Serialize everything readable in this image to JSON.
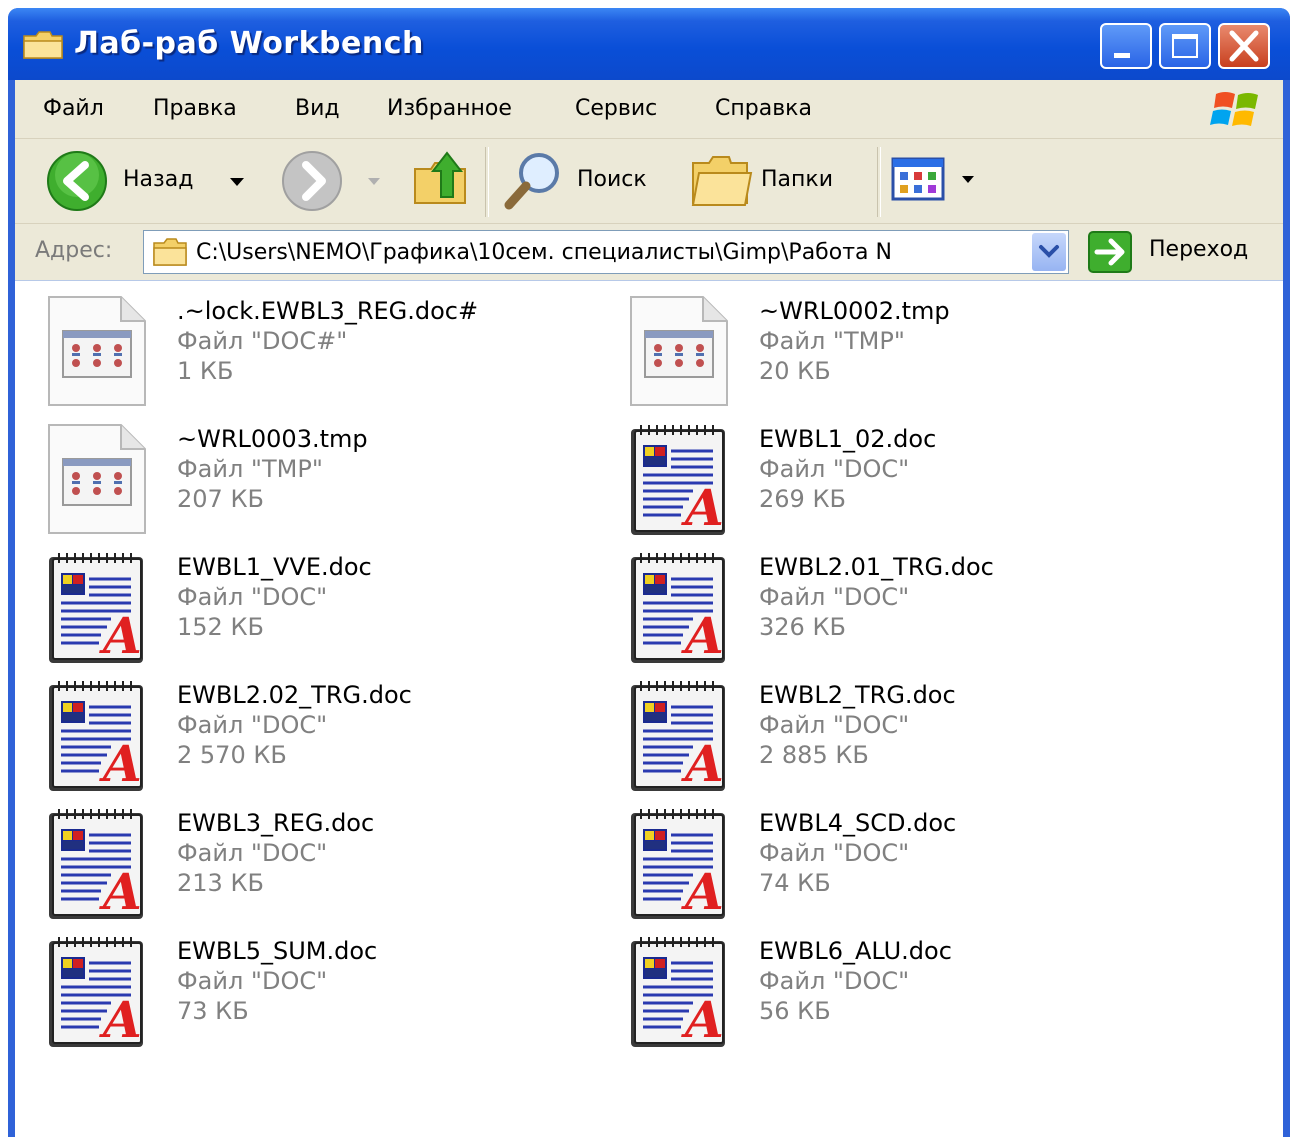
{
  "window": {
    "title": "Лаб-раб Workbench"
  },
  "menu": {
    "items": [
      "Файл",
      "Правка",
      "Вид",
      "Избранное",
      "Сервис",
      "Справка"
    ]
  },
  "toolbar": {
    "back_label": "Назад",
    "search_label": "Поиск",
    "folders_label": "Папки"
  },
  "address": {
    "label": "Адрес:",
    "path": "C:\\Users\\NEMO\\Графика\\10сем. специалисты\\Gimp\\Работа N",
    "go_label": "Переход"
  },
  "files": [
    {
      "name": ".~lock.EWBL3_REG.doc#",
      "type": "Файл \"DOC#\"",
      "size": "1 КБ",
      "icon": "generic-file-icon"
    },
    {
      "name": "~WRL0002.tmp",
      "type": "Файл \"TMP\"",
      "size": "20 КБ",
      "icon": "generic-file-icon"
    },
    {
      "name": "~WRL0003.tmp",
      "type": "Файл \"TMP\"",
      "size": "207 КБ",
      "icon": "generic-file-icon"
    },
    {
      "name": "EWBL1_02.doc",
      "type": "Файл \"DOC\"",
      "size": "269 КБ",
      "icon": "word-document-icon"
    },
    {
      "name": "EWBL1_VVE.doc",
      "type": "Файл \"DOC\"",
      "size": "152 КБ",
      "icon": "word-document-icon"
    },
    {
      "name": "EWBL2.01_TRG.doc",
      "type": "Файл \"DOC\"",
      "size": "326 КБ",
      "icon": "word-document-icon"
    },
    {
      "name": "EWBL2.02_TRG.doc",
      "type": "Файл \"DOC\"",
      "size": "2 570 КБ",
      "icon": "word-document-icon"
    },
    {
      "name": "EWBL2_TRG.doc",
      "type": "Файл \"DOC\"",
      "size": "2 885 КБ",
      "icon": "word-document-icon"
    },
    {
      "name": "EWBL3_REG.doc",
      "type": "Файл \"DOC\"",
      "size": "213 КБ",
      "icon": "word-document-icon"
    },
    {
      "name": "EWBL4_SCD.doc",
      "type": "Файл \"DOC\"",
      "size": "74 КБ",
      "icon": "word-document-icon"
    },
    {
      "name": "EWBL5_SUM.doc",
      "type": "Файл \"DOC\"",
      "size": "73 КБ",
      "icon": "word-document-icon"
    },
    {
      "name": "EWBL6_ALU.doc",
      "type": "Файл \"DOC\"",
      "size": "56 КБ",
      "icon": "word-document-icon"
    }
  ],
  "colors": {
    "titlebar": "#0a4fd8",
    "frame": "#2f62d8",
    "chrome": "#ece9d8",
    "secondary_text": "#808080"
  }
}
